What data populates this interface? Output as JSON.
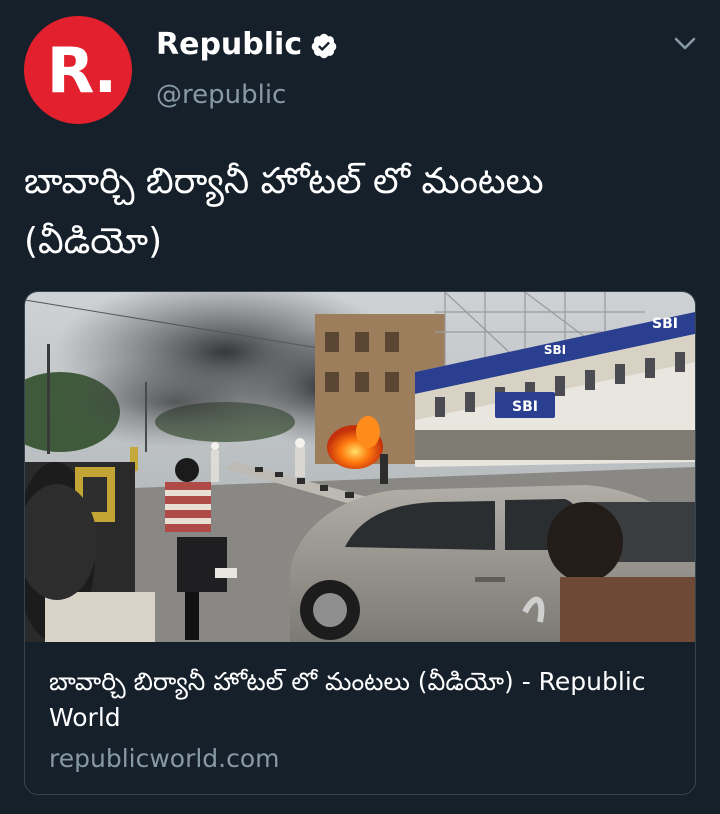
{
  "tweet": {
    "author": {
      "display_name": "Republic",
      "handle": "@republic",
      "avatar_text": "R.",
      "verified": true,
      "avatar_color": "#e3202e"
    },
    "text": "బావార్చి బిర్యానీ హోటల్ లో మంటలు (వీడియో)",
    "menu_icon": "chevron-down-icon"
  },
  "card": {
    "title": "బావార్చి బిర్యానీ హోటల్ లో మంటలు (వీడియో) - Republic World",
    "domain": "republicworld.com",
    "image": {
      "description_icon": "news-photo",
      "sign_texts": {
        "sbi_right": "SBI",
        "sbi_mid": "SBI",
        "sbi_main": "SBI"
      }
    }
  },
  "theme": {
    "background": "#15202b",
    "secondary_text": "#8899a6",
    "border": "#38444d"
  }
}
